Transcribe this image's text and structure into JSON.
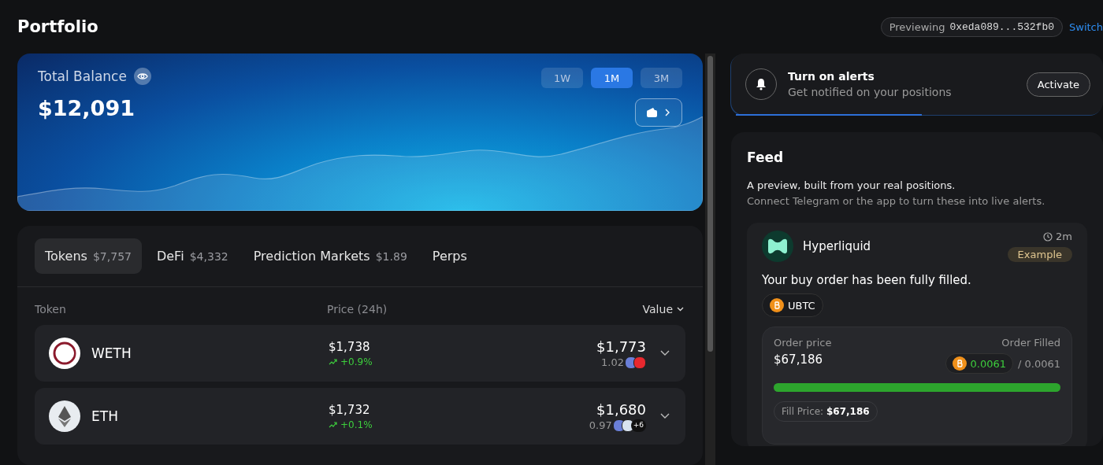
{
  "page": {
    "title": "Portfolio",
    "previewing_label": "Previewing",
    "address": "0xeda089...532fb0",
    "switch_link": "Switch"
  },
  "balance": {
    "label": "Total Balance",
    "amount": "$12,091",
    "ranges": [
      {
        "label": "1W",
        "selected": false
      },
      {
        "label": "1M",
        "selected": true
      },
      {
        "label": "3M",
        "selected": false
      }
    ]
  },
  "tabs": [
    {
      "label": "Tokens",
      "amount": "$7,757",
      "selected": true
    },
    {
      "label": "DeFi",
      "amount": "$4,332",
      "selected": false
    },
    {
      "label": "Prediction Markets",
      "amount": "$1.89",
      "selected": false
    },
    {
      "label": "Perps",
      "selected": false
    }
  ],
  "table": {
    "columns": [
      "Token",
      "Price (24h)",
      "Value"
    ],
    "rows": [
      {
        "token": "WETH",
        "price": "$1,738",
        "change": "+0.9%",
        "value": "$1,773",
        "quantity": "1.02",
        "chains": [
          {
            "color": "#6a7fd8"
          },
          {
            "color": "#e8282f"
          }
        ]
      },
      {
        "token": "ETH",
        "price": "$1,732",
        "change": "+0.1%",
        "value": "$1,680",
        "quantity": "0.97",
        "chains": [
          {
            "color": "#6a7fd8"
          },
          {
            "color": "#d9e4f0"
          }
        ],
        "more_chains": "+6"
      }
    ]
  },
  "alerts": {
    "title": "Turn on alerts",
    "subtitle": "Get notified on your positions",
    "button": "Activate",
    "level": 0.5
  },
  "feed": {
    "title": "Feed",
    "intro": "A preview, built from your real positions.",
    "hint": "Connect Telegram or the app to turn these into live alerts.",
    "items": [
      {
        "source": "Hyperliquid",
        "time": "2m",
        "badge": "Example",
        "message": "Your buy order has been fully filled.",
        "asset": "UBTC",
        "order_price_label": "Order price",
        "order_price": "$67,186",
        "filled_label": "Order Filled",
        "filled": "0.0061",
        "total": "/ 0.0061",
        "level": 1,
        "fill_price_label": "Fill Price:",
        "fill_price": "$67,186"
      }
    ]
  }
}
